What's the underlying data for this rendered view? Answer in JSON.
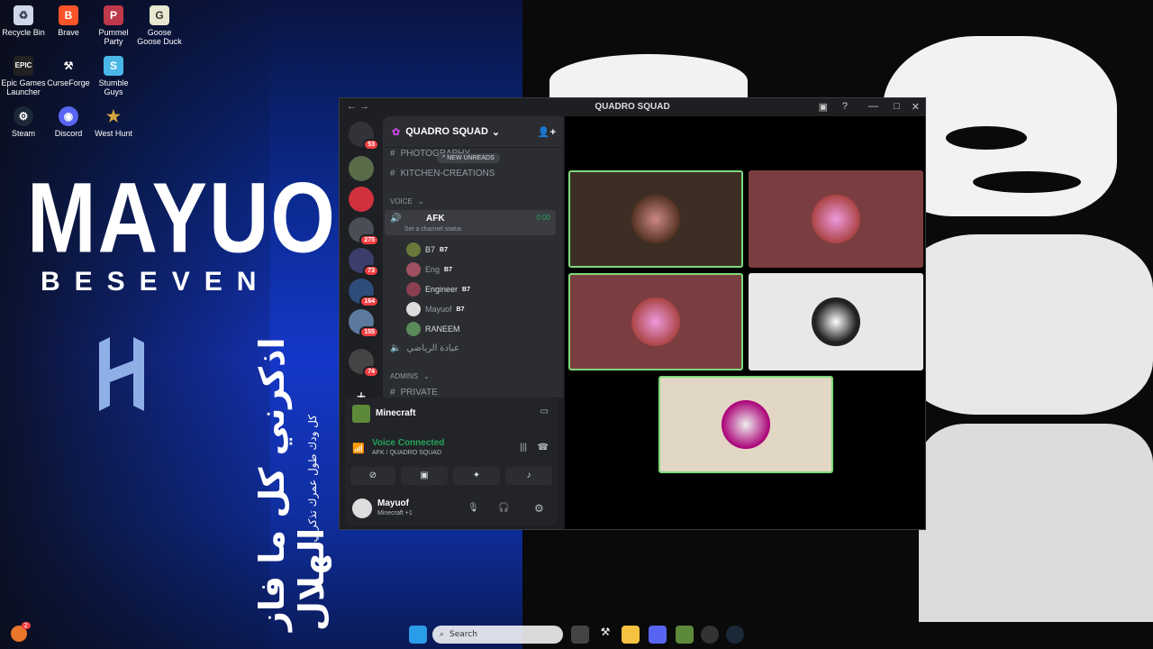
{
  "desktop": {
    "icons": [
      {
        "label": "Recycle Bin",
        "icon": "recycle-bin-icon"
      },
      {
        "label": "Brave",
        "icon": "brave-icon"
      },
      {
        "label": "Pummel Party",
        "icon": "pummel-party-icon"
      },
      {
        "label": "Goose Goose Duck",
        "icon": "goose-goose-duck-icon"
      },
      {
        "label": "Epic Games Launcher",
        "icon": "epic-games-icon"
      },
      {
        "label": "CurseForge",
        "icon": "curseforge-icon"
      },
      {
        "label": "Stumble Guys",
        "icon": "stumble-guys-icon"
      },
      {
        "label": "Steam",
        "icon": "steam-icon"
      },
      {
        "label": "Discord",
        "icon": "discord-icon"
      },
      {
        "label": "West Hunt",
        "icon": "west-hunt-icon"
      }
    ],
    "wallpaper": {
      "brand": "MAYUOF",
      "brand_sub": "BESEVEN",
      "arabic_main": "اذكرني كل ما فاز الهلال",
      "arabic_sub": "كل ودك طول عمرك تذكرني"
    }
  },
  "window": {
    "title": "QUADRO SQUAD",
    "server_name": "QUADRO SQUAD",
    "new_unreads": "NEW UNREADS",
    "text_channels": [
      "PHOTOGRAPHY",
      "KITCHEN-CREATIONS"
    ],
    "voice_header": "VOICE",
    "afk_channel": "AFK",
    "afk_timer": "0:00",
    "channel_status_hint": "Set a channel status",
    "voice_users": [
      {
        "name": "B7",
        "tag": "B7"
      },
      {
        "name": "Eng",
        "tag": "B7"
      },
      {
        "name": "Engineer",
        "tag": "B7"
      },
      {
        "name": "Mayuof",
        "tag": "B7"
      },
      {
        "name": "RANEEM",
        "tag": ""
      }
    ],
    "arabic_channel": "عيادة الرياضي",
    "admins_header": "ADMINS",
    "private_channel": "PRIVATE",
    "server_badges": [
      "53",
      "275",
      "73",
      "164",
      "155",
      "74"
    ],
    "activity": {
      "game": "Minecraft"
    },
    "voice": {
      "status": "Voice Connected",
      "location": "AFK / QUADRO SQUAD"
    },
    "user": {
      "name": "Mayuof",
      "status": "Minecraft +1"
    }
  },
  "taskbar": {
    "search_placeholder": "Search",
    "notif_badge": "2"
  },
  "colors": {
    "accent_green": "#23a55a",
    "speaking_border": "#7dd97a",
    "badge_red": "#f23f43",
    "discord_bg": "#1e1f22",
    "sidebar_bg": "#2b2d31"
  }
}
